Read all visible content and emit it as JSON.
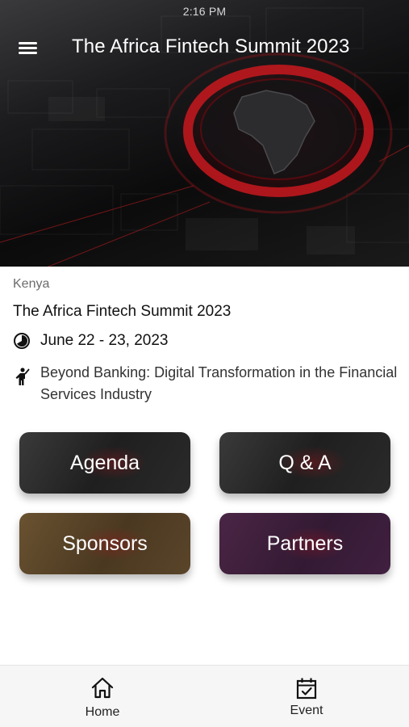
{
  "status_bar": {
    "time": "2:16 PM"
  },
  "header": {
    "title": "The Africa Fintech Summit 2023",
    "menu_icon": "hamburger-menu-icon"
  },
  "event": {
    "country": "Kenya",
    "name": "The Africa Fintech Summit 2023",
    "date": "June 22 - 23, 2023",
    "theme": "Beyond Banking:  Digital Transformation in the Financial Services Industry"
  },
  "tiles": [
    {
      "label": "Agenda"
    },
    {
      "label": "Q & A"
    },
    {
      "label": "Sponsors"
    },
    {
      "label": "Partners"
    }
  ],
  "bottom_nav": {
    "items": [
      {
        "label": "Home",
        "icon": "home-icon"
      },
      {
        "label": "Event",
        "icon": "calendar-check-icon"
      }
    ]
  }
}
